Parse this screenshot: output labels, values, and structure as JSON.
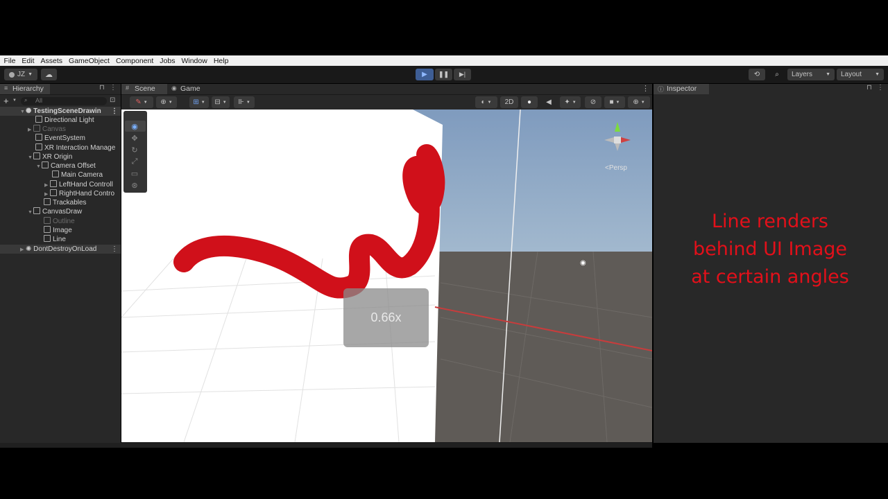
{
  "menu": [
    "File",
    "Edit",
    "Assets",
    "GameObject",
    "Component",
    "Jobs",
    "Window",
    "Help"
  ],
  "toolbar": {
    "account": "JZ",
    "layers": "Layers",
    "layout": "Layout"
  },
  "hierarchy": {
    "title": "Hierarchy",
    "search_placeholder": "All",
    "items": [
      {
        "label": "TestingSceneDrawin"
      },
      {
        "label": "Directional Light"
      },
      {
        "label": "Canvas"
      },
      {
        "label": "EventSystem"
      },
      {
        "label": "XR Interaction Manage"
      },
      {
        "label": "XR Origin"
      },
      {
        "label": "Camera Offset"
      },
      {
        "label": "Main Camera"
      },
      {
        "label": "LeftHand Controll"
      },
      {
        "label": "RightHand Contro"
      },
      {
        "label": "Trackables"
      },
      {
        "label": "CanvasDraw"
      },
      {
        "label": "Outline"
      },
      {
        "label": "Image"
      },
      {
        "label": "Line"
      },
      {
        "label": "DontDestroyOnLoad"
      }
    ]
  },
  "scene": {
    "tabs": {
      "scene": "Scene",
      "game": "Game"
    },
    "mode_2d": "2D",
    "persp": "<Persp",
    "zoom": "0.66x"
  },
  "inspector": {
    "title": "Inspector"
  },
  "caption": [
    "Line renders",
    "behind UI Image",
    "at certain angles"
  ],
  "colors": {
    "accent_blue": "#4a7fd6",
    "line_red": "#d0101a",
    "caption_red": "#e3101a"
  }
}
